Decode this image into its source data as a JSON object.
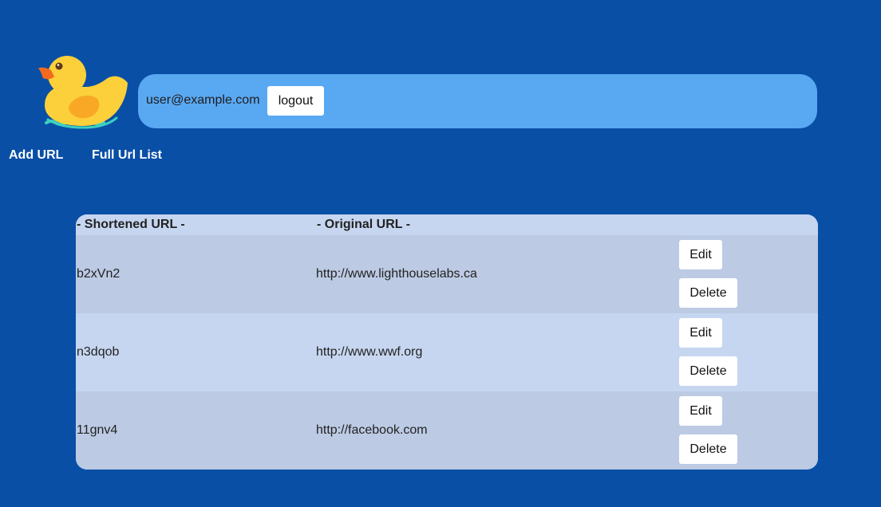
{
  "header": {
    "user_email": "user@example.com",
    "logout_label": "logout"
  },
  "nav": {
    "add_url": "Add URL",
    "full_list": "Full Url List"
  },
  "table": {
    "columns": [
      "- Shortened URL -",
      "- Original URL -"
    ],
    "rows": [
      {
        "short": "b2xVn2",
        "original": "http://www.lighthouselabs.ca",
        "edit": "Edit",
        "delete": "Delete"
      },
      {
        "short": "n3dqob",
        "original": "http://www.wwf.org",
        "edit": "Edit",
        "delete": "Delete"
      },
      {
        "short": "11gnv4",
        "original": "http://facebook.com",
        "edit": "Edit",
        "delete": "Delete"
      }
    ]
  },
  "colors": {
    "page_bg": "#094FA6",
    "user_bar": "#59A8F2",
    "table_bg": "#C6D6F0",
    "row_alt": "#BCCAE4"
  },
  "icons": {
    "logo": "rubber-duck-icon"
  }
}
